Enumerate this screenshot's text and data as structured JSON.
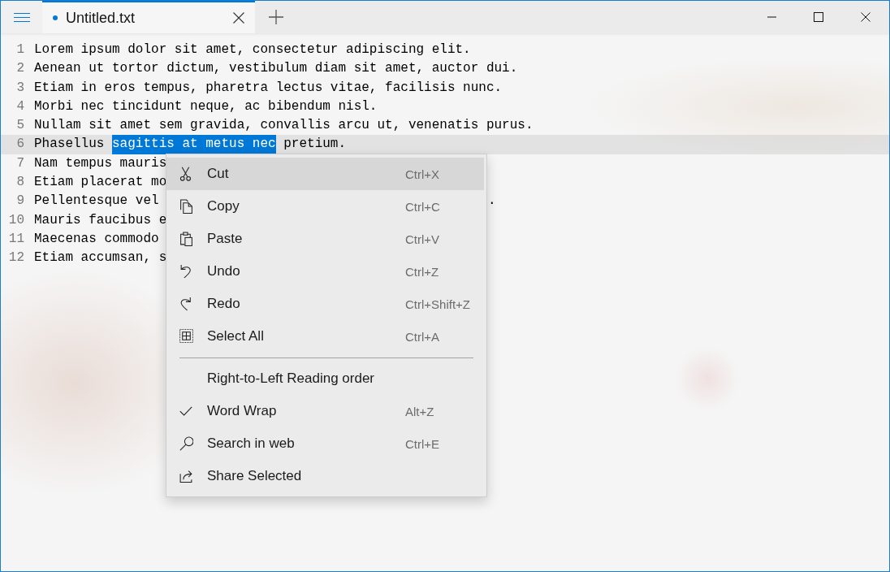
{
  "window": {
    "tabs": [
      {
        "title": "Untitled.txt",
        "selected": true,
        "modified": true
      }
    ]
  },
  "editor": {
    "lines": [
      {
        "number": "1",
        "current": false,
        "segments": [
          {
            "text": "Lorem ipsum dolor sit amet, consectetur adipiscing elit.",
            "selected": false
          }
        ]
      },
      {
        "number": "2",
        "current": false,
        "segments": [
          {
            "text": "Aenean ut tortor dictum, vestibulum diam sit amet, auctor dui.",
            "selected": false
          }
        ]
      },
      {
        "number": "3",
        "current": false,
        "segments": [
          {
            "text": "Etiam in eros tempus, pharetra lectus vitae, facilisis nunc.",
            "selected": false
          }
        ]
      },
      {
        "number": "4",
        "current": false,
        "segments": [
          {
            "text": "Morbi nec tincidunt neque, ac bibendum nisl.",
            "selected": false
          }
        ]
      },
      {
        "number": "5",
        "current": false,
        "segments": [
          {
            "text": "Nullam sit amet sem gravida, convallis arcu ut, venenatis purus.",
            "selected": false
          }
        ]
      },
      {
        "number": "6",
        "current": true,
        "segments": [
          {
            "text": "Phasellus ",
            "selected": false
          },
          {
            "text": "sagittis at metus nec",
            "selected": true
          },
          {
            "text": " pretium.",
            "selected": false
          }
        ]
      },
      {
        "number": "7",
        "current": false,
        "segments": [
          {
            "text": "Nam tempus mauris",
            "selected": false
          }
        ]
      },
      {
        "number": "8",
        "current": false,
        "segments": [
          {
            "text": "Etiam placerat mo",
            "selected": false
          }
        ]
      },
      {
        "number": "9",
        "current": false,
        "segments": [
          {
            "text": "Pellentesque vel",
            "selected": false
          }
        ],
        "text_after_menu": "."
      },
      {
        "number": "10",
        "current": false,
        "segments": [
          {
            "text": "Mauris faucibus e",
            "selected": false
          }
        ]
      },
      {
        "number": "11",
        "current": false,
        "segments": [
          {
            "text": "Maecenas commodo",
            "selected": false
          }
        ]
      },
      {
        "number": "12",
        "current": false,
        "segments": [
          {
            "text": "Etiam accumsan, s",
            "selected": false
          }
        ]
      }
    ]
  },
  "context_menu": {
    "groups": [
      [
        {
          "kind": "command",
          "label": "Cut",
          "shortcut": "Ctrl+X",
          "highlighted": true
        },
        {
          "kind": "command",
          "label": "Copy",
          "shortcut": "Ctrl+C",
          "highlighted": false
        },
        {
          "kind": "command",
          "label": "Paste",
          "shortcut": "Ctrl+V",
          "highlighted": false
        },
        {
          "kind": "command",
          "label": "Undo",
          "shortcut": "Ctrl+Z",
          "highlighted": false
        },
        {
          "kind": "command",
          "label": "Redo",
          "shortcut": "Ctrl+Shift+Z",
          "highlighted": false
        },
        {
          "kind": "command",
          "label": "Select All",
          "shortcut": "Ctrl+A",
          "highlighted": false
        }
      ],
      [
        {
          "kind": "toggle",
          "label": "Right-to-Left Reading order",
          "checked": false,
          "highlighted": false
        },
        {
          "kind": "toggle",
          "label": "Word Wrap",
          "shortcut": "Alt+Z",
          "checked": true,
          "highlighted": false
        },
        {
          "kind": "command",
          "label": "Search in web",
          "shortcut": "Ctrl+E",
          "highlighted": false
        },
        {
          "kind": "command",
          "label": "Share Selected",
          "highlighted": false
        }
      ]
    ]
  }
}
